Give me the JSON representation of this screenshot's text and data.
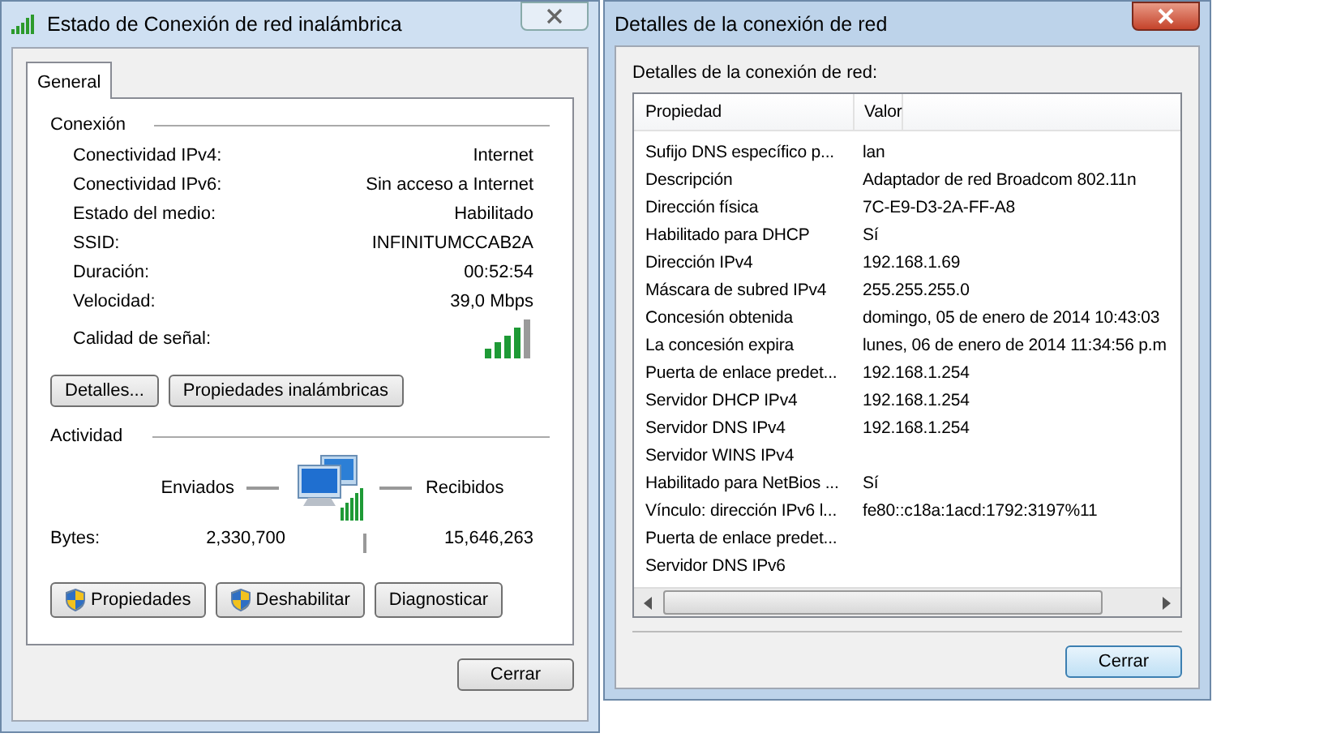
{
  "status_window": {
    "title": "Estado de Conexión de red inalámbrica",
    "tabs": [
      {
        "label": "General",
        "selected": true
      }
    ],
    "connection": {
      "heading": "Conexión",
      "rows": [
        {
          "label": "Conectividad IPv4:",
          "value": "Internet"
        },
        {
          "label": "Conectividad IPv6:",
          "value": "Sin acceso a Internet"
        },
        {
          "label": "Estado del medio:",
          "value": "Habilitado"
        },
        {
          "label": "SSID:",
          "value": "INFINITUMCCAB2A"
        },
        {
          "label": "Duración:",
          "value": "00:52:54"
        },
        {
          "label": "Velocidad:",
          "value": "39,0 Mbps"
        }
      ],
      "signal_label": "Calidad de señal:"
    },
    "buttons": [
      "Detalles...",
      "Propiedades inalámbricas"
    ],
    "activity": {
      "heading": "Actividad",
      "sent_label": "Enviados",
      "received_label": "Recibidos",
      "bytes_label": "Bytes:",
      "sent": "2,330,700",
      "received": "15,646,263"
    },
    "action_buttons": [
      {
        "label": "Propiedades",
        "kind": "shield"
      },
      {
        "label": "Deshabilitar",
        "kind": "shield"
      },
      {
        "label": "Diagnosticar",
        "kind": "plain"
      }
    ],
    "close_button": "Cerrar"
  },
  "details_window": {
    "title": "Detalles de la conexión de red",
    "caption": "Detalles de la conexión de red:",
    "columns": [
      "Propiedad",
      "Valor"
    ],
    "rows": [
      {
        "property": "Sufijo DNS específico p...",
        "value": "lan"
      },
      {
        "property": "Descripción",
        "value": "Adaptador de red Broadcom 802.11n"
      },
      {
        "property": "Dirección física",
        "value": "7C-E9-D3-2A-FF-A8"
      },
      {
        "property": "Habilitado para DHCP",
        "value": "Sí"
      },
      {
        "property": "Dirección IPv4",
        "value": "192.168.1.69"
      },
      {
        "property": "Máscara de subred IPv4",
        "value": "255.255.255.0"
      },
      {
        "property": "Concesión obtenida",
        "value": "domingo, 05 de enero de 2014 10:43:03"
      },
      {
        "property": "La concesión expira",
        "value": "lunes, 06 de enero de 2014 11:34:56 p.m"
      },
      {
        "property": "Puerta de enlace predet...",
        "value": "192.168.1.254"
      },
      {
        "property": "Servidor DHCP IPv4",
        "value": "192.168.1.254"
      },
      {
        "property": "Servidor DNS IPv4",
        "value": "192.168.1.254"
      },
      {
        "property": "Servidor WINS IPv4",
        "value": ""
      },
      {
        "property": "Habilitado para NetBios ...",
        "value": "Sí"
      },
      {
        "property": "Vínculo: dirección IPv6 l...",
        "value": "fe80::c18a:1acd:1792:3197%11"
      },
      {
        "property": "Puerta de enlace predet...",
        "value": ""
      },
      {
        "property": "Servidor DNS IPv6",
        "value": ""
      }
    ],
    "close_button": "Cerrar"
  }
}
